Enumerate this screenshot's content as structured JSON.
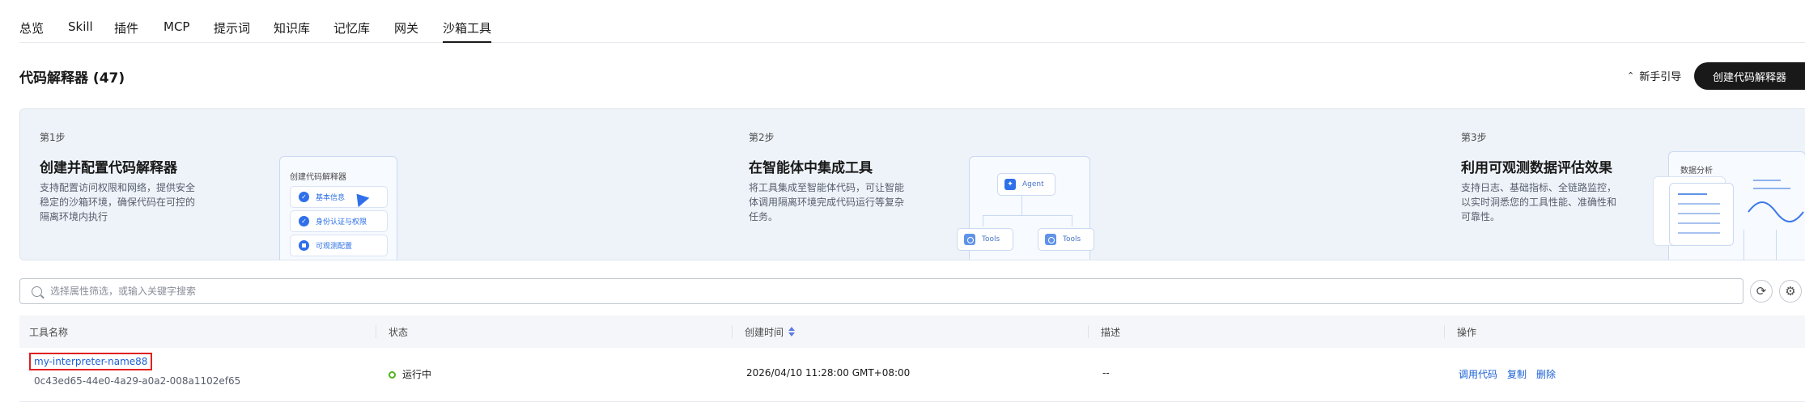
{
  "tabs": [
    "总览",
    "Skill",
    "插件",
    "MCP",
    "提示词",
    "知识库",
    "记忆库",
    "网关",
    "沙箱工具"
  ],
  "active_tab": "沙箱工具",
  "page": {
    "title": "代码解释器 (47)",
    "guide_label": "新手引导",
    "create_label": "创建代码解释器"
  },
  "steps": [
    {
      "num": "第1步",
      "title": "创建并配置代码解释器",
      "desc": "支持配置访问权限和网络，提供安全稳定的沙箱环境，确保代码在可控的隔离环境内执行",
      "illu": {
        "heading": "创建代码解释器",
        "items": [
          "基本信息",
          "身份认证与权限",
          "可观测配置"
        ]
      }
    },
    {
      "num": "第2步",
      "title": "在智能体中集成工具",
      "desc": "将工具集成至智能体代码，可让智能体调用隔离环境完成代码运行等复杂任务。",
      "illu": {
        "agent": "Agent",
        "tools": [
          "Tools",
          "Tools"
        ]
      }
    },
    {
      "num": "第3步",
      "title": "利用可观测数据评估效果",
      "desc": "支持日志、基础指标、全链路监控，以实时洞悉您的工具性能、准确性和可靠性。",
      "illu": {
        "heading": "数据分析"
      }
    }
  ],
  "search": {
    "placeholder": "选择属性筛选，或输入关键字搜索"
  },
  "table": {
    "headers": [
      "工具名称",
      "状态",
      "创建时间",
      "描述",
      "操作"
    ],
    "rows": [
      {
        "name": "my-interpreter-name88",
        "id": "0c43ed65-44e0-4a29-a0a2-008a1102ef65",
        "status": "运行中",
        "created": "2026/04/10 11:28:00 GMT+08:00",
        "desc": "--",
        "ops": [
          "调用代码",
          "复制",
          "删除"
        ]
      }
    ]
  },
  "colors": {
    "accent": "#2f6fea",
    "link": "#1a5fd6",
    "status_running": "#50b41e",
    "highlight_box": "#e0201f"
  }
}
